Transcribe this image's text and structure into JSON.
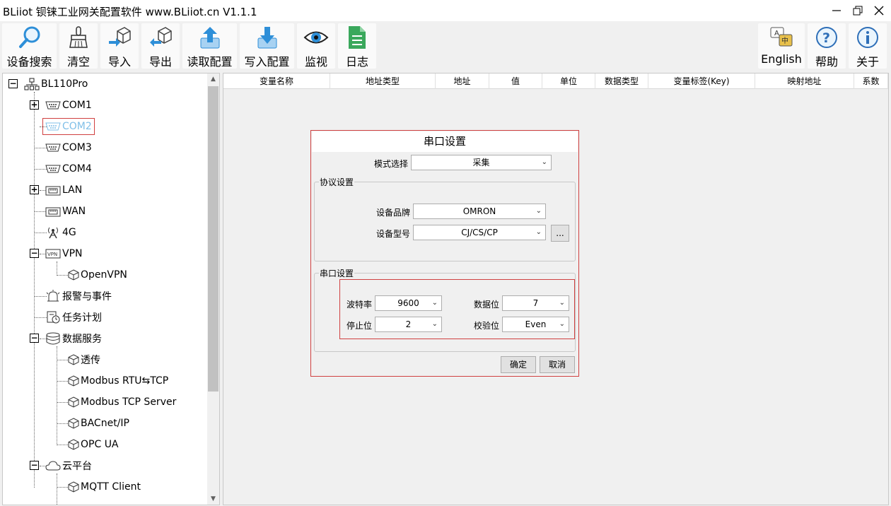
{
  "window": {
    "title": "BLiiot 钡铼工业网关配置软件 www.BLiiot.cn V1.1.1"
  },
  "toolbar": {
    "search": "设备搜索",
    "clear": "清空",
    "import": "导入",
    "export": "导出",
    "read_config": "读取配置",
    "write_config": "写入配置",
    "monitor": "监视",
    "log": "日志",
    "english": "English",
    "help": "帮助",
    "about": "关于"
  },
  "tree": {
    "root": "BL110Pro",
    "com1": "COM1",
    "com2": "COM2",
    "com3": "COM3",
    "com4": "COM4",
    "lan": "LAN",
    "wan": "WAN",
    "g4": "4G",
    "vpn": "VPN",
    "openvpn": "OpenVPN",
    "alarm": "报警与事件",
    "task": "任务计划",
    "data_service": "数据服务",
    "transparent": "透传",
    "modbus_rtu_tcp": "Modbus RTU⇆TCP",
    "modbus_tcp_server": "Modbus TCP Server",
    "bacnet": "BACnet/IP",
    "opcua": "OPC UA",
    "cloud": "云平台",
    "mqtt_client": "MQTT Client"
  },
  "table": {
    "columns": [
      "变量名称",
      "地址类型",
      "地址",
      "值",
      "单位",
      "数据类型",
      "变量标签(Key)",
      "映射地址",
      "系数"
    ]
  },
  "dialog": {
    "title": "串口设置",
    "mode_label": "模式选择",
    "mode_value": "采集",
    "protocol_group": "协议设置",
    "brand_label": "设备品牌",
    "brand_value": "OMRON",
    "model_label": "设备型号",
    "model_value": "CJ/CS/CP",
    "more_button": "...",
    "serial_group": "串口设置",
    "baud_label": "波特率",
    "baud_value": "9600",
    "databits_label": "数据位",
    "databits_value": "7",
    "stopbits_label": "停止位",
    "stopbits_value": "2",
    "parity_label": "校验位",
    "parity_value": "Even",
    "ok": "确定",
    "cancel": "取消"
  },
  "colors": {
    "highlight_border": "#d04040",
    "selected_text": "#7fbfe8",
    "accent_blue": "#2e8fd8"
  }
}
